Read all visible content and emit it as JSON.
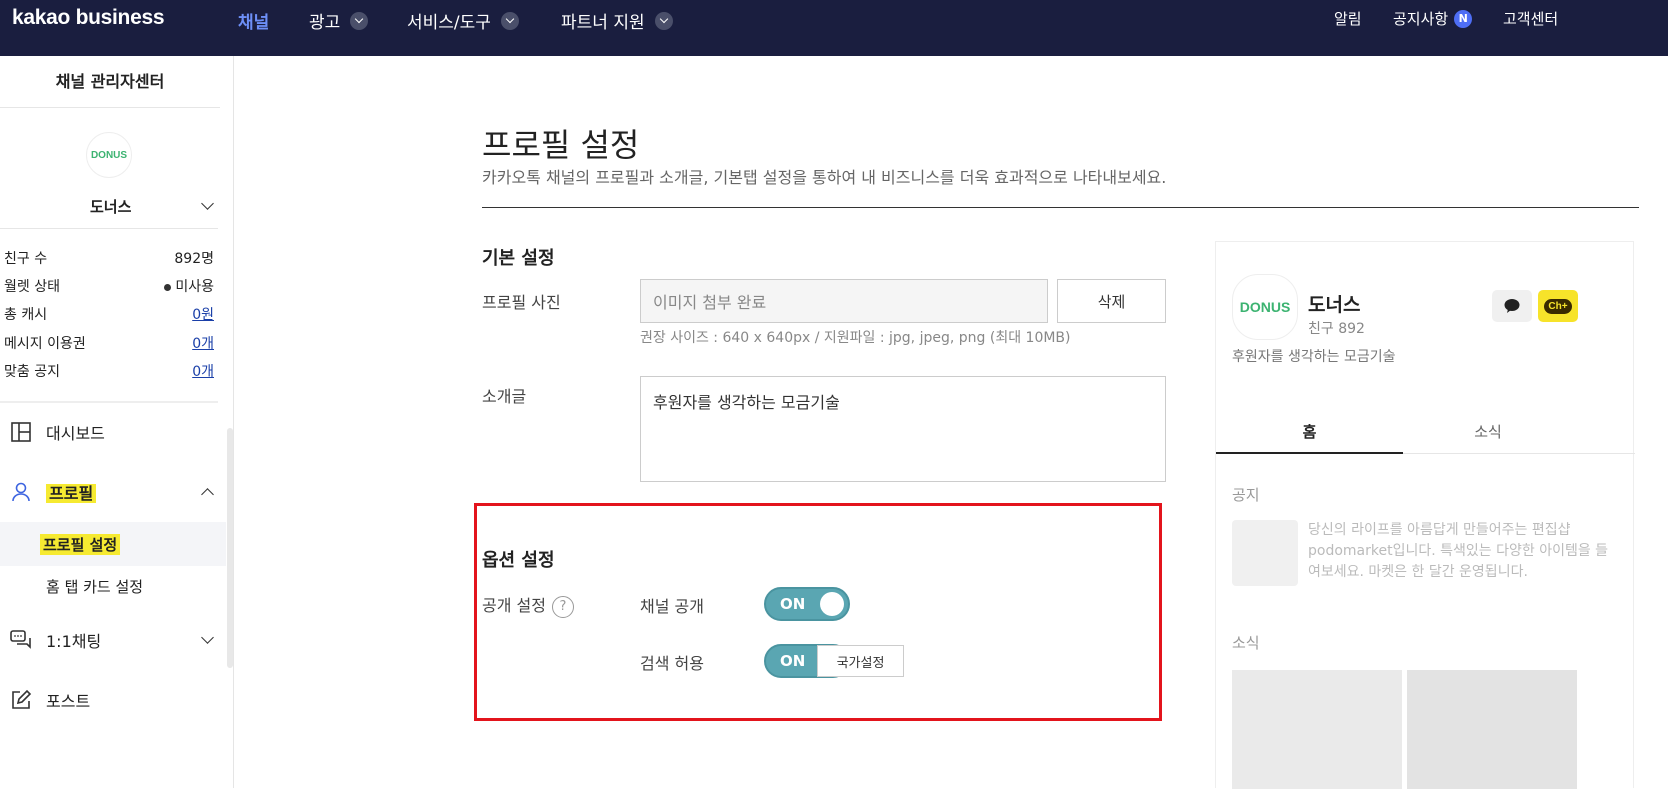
{
  "topbar": {
    "logo": "kakao business",
    "nav": [
      {
        "label": "채널",
        "active": true,
        "dropdown": false
      },
      {
        "label": "광고",
        "active": false,
        "dropdown": true
      },
      {
        "label": "서비스/도구",
        "active": false,
        "dropdown": true
      },
      {
        "label": "파트너 지원",
        "active": false,
        "dropdown": true
      }
    ],
    "right": {
      "alerts": "알림",
      "notices": "공지사항",
      "notices_badge": "N",
      "support": "고객센터"
    }
  },
  "sidebar": {
    "title": "채널 관리자센터",
    "channel": {
      "avatar_text": "DONUS",
      "name": "도너스"
    },
    "stats": [
      {
        "label": "친구 수",
        "value": "892명"
      },
      {
        "label": "월렛 상태",
        "value": "미사용"
      },
      {
        "label": "총 캐시",
        "value": "0원"
      },
      {
        "label": "메시지 이용권",
        "value": "0개"
      },
      {
        "label": "맞춤 공지",
        "value": "0개"
      }
    ],
    "menu": {
      "dashboard": "대시보드",
      "profile": "프로필",
      "profile_settings": "프로필 설정",
      "home_tab_card": "홈 탭 카드 설정",
      "chat": "1:1채팅",
      "post": "포스트"
    }
  },
  "main": {
    "title": "프로필 설정",
    "description": "카카오톡 채널의 프로필과 소개글, 기본탭 설정을 통하여 내 비즈니스를 더욱 효과적으로 나타내보세요.",
    "basic": {
      "title": "기본 설정",
      "photo_label": "프로필 사진",
      "photo_value": "이미지 첨부 완료",
      "delete_button": "삭제",
      "photo_hint": "권장 사이즈 : 640 x 640px / 지원파일 : jpg, jpeg, png (최대 10MB)",
      "intro_label": "소개글",
      "intro_value": "후원자를 생각하는 모금기술"
    },
    "options": {
      "title": "옵션 설정",
      "visibility_label": "공개 설정",
      "help": "?",
      "channel_public_label": "채널 공개",
      "channel_public_state": "ON",
      "search_allow_label": "검색 허용",
      "search_allow_state": "ON",
      "country_button": "국가설정"
    }
  },
  "preview": {
    "avatar_text": "DONUS",
    "name": "도너스",
    "friends": "친구 892",
    "description": "후원자를 생각하는 모금기술",
    "chat_icon": "chat-bubble-icon",
    "add_channel_icon": "ch-plus-icon",
    "add_channel_text": "Ch+",
    "tabs": [
      "홈",
      "소식"
    ],
    "notice_title": "공지",
    "notice_text": "당신의 라이프를 아름답게 만들어주는 편집샵 podomarket입니다. 특색있는 다양한 아이템을 들여보세요. 마켓은 한 달간 운영됩니다.",
    "news_title": "소식"
  },
  "colors": {
    "topbar_bg": "#1a1e3f",
    "nav_active": "#6d8ff7",
    "toggle_on": "#5aa6b2",
    "highlight": "#f6ea31",
    "red_box": "#e3141c",
    "kakao_yellow": "#f7e32a"
  }
}
